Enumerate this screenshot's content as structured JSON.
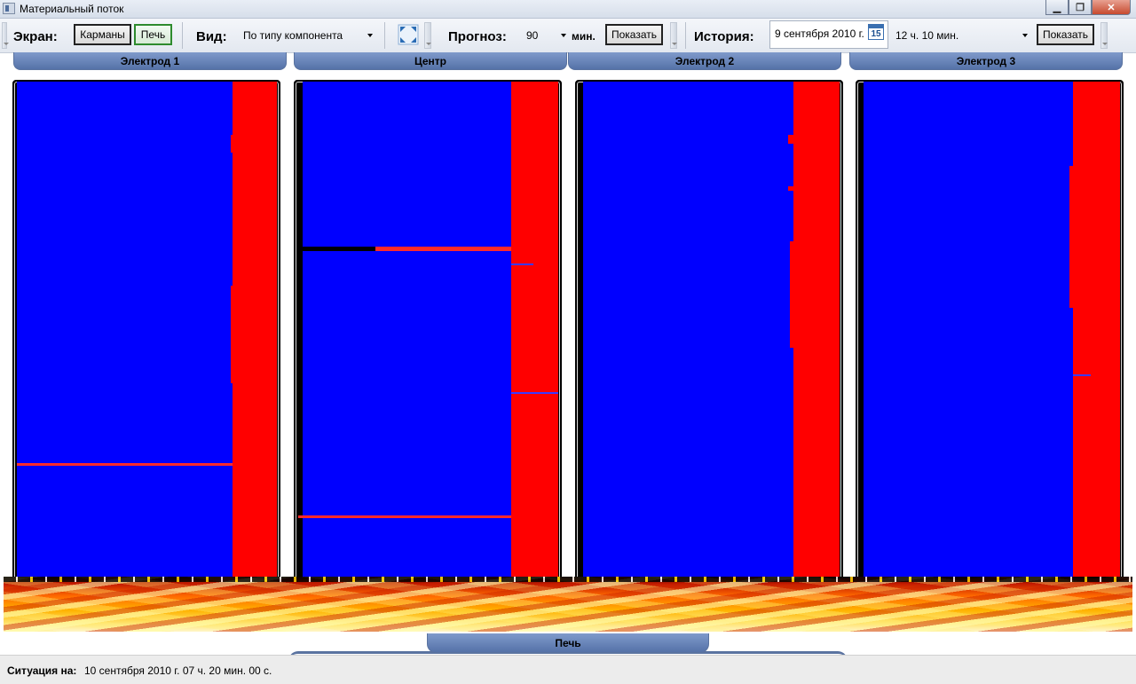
{
  "window": {
    "title": "Материальный поток"
  },
  "toolbar": {
    "screen_label": "Экран:",
    "pockets_button": "Карманы",
    "furnace_button": "Печь",
    "view_label": "Вид:",
    "view_value": "По типу компонента",
    "forecast_label": "Прогноз:",
    "forecast_value": "90",
    "forecast_unit": "мин.",
    "forecast_show_button": "Показать",
    "history_label": "История:",
    "history_date": "9 сентября 2010 г.",
    "calendar_day": "15",
    "history_time": "12 ч. 10 мин.",
    "history_show_button": "Показать"
  },
  "tabs": {
    "electrode1": "Электрод 1",
    "center": "Центр",
    "electrode2": "Электрод 2",
    "electrode3": "Электрод 3",
    "furnace": "Печь"
  },
  "colors": {
    "component_a": "#0000ff",
    "component_b": "#ff0000",
    "background": "#000000"
  },
  "status": {
    "label": "Ситуация на:",
    "value": "10 сентября 2010 г.  07 ч. 20 мин. 00 с."
  }
}
